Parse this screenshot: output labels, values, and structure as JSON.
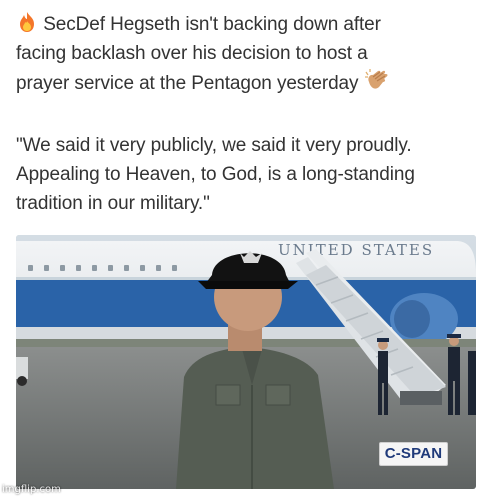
{
  "post": {
    "headline_lines": [
      "SecDef Hegseth isn't backing down after",
      "facing backlash over his decision to host a",
      "prayer service at the Pentagon yesterday"
    ],
    "quote_lines": [
      "\"We said it very publicly, we said it very proudly.",
      "Appealing to Heaven, to God, is a long-standing",
      "tradition in our military.\""
    ],
    "lead_emoji": "fire-icon",
    "trail_emoji": "clapping-hands-icon"
  },
  "media": {
    "plane_lettering": "UNITED STATES",
    "channel_logo": "C-SPAN"
  },
  "watermark": "imgflip.com",
  "colors": {
    "text": "#333333",
    "plane_blue": "#2a63a8",
    "sky": "#cdd7de"
  }
}
